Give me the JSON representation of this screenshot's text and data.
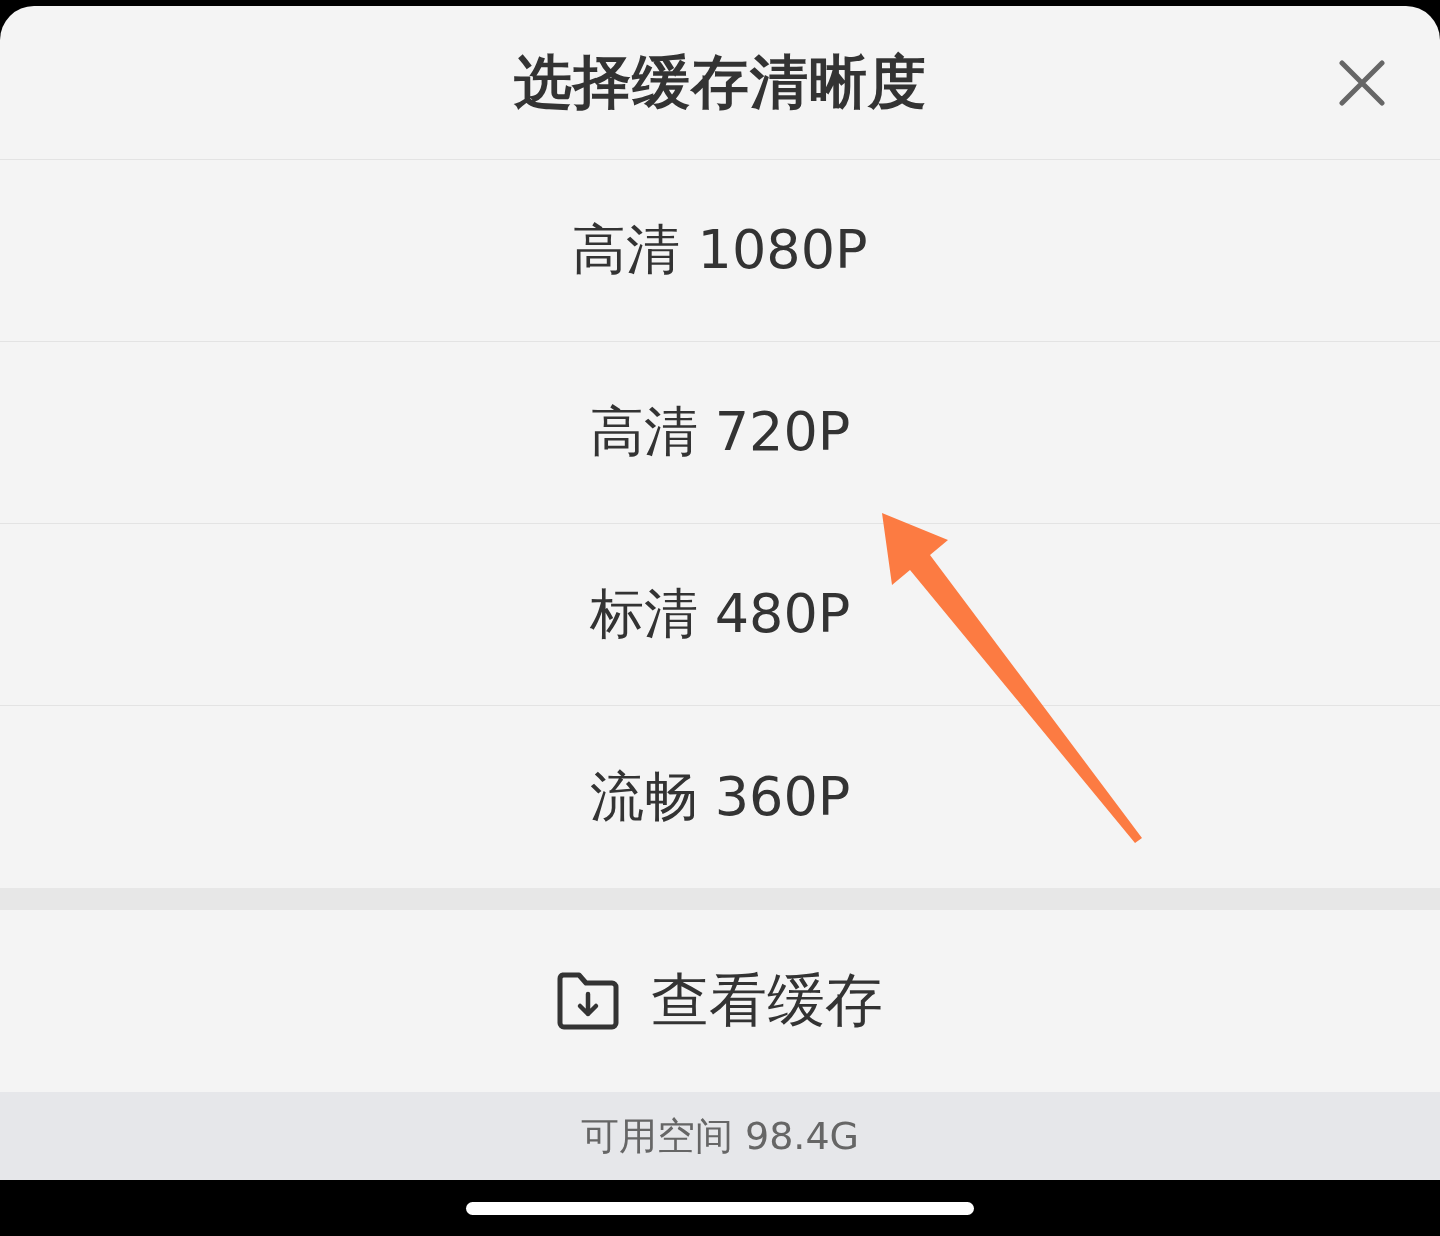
{
  "sheet": {
    "title": "选择缓存清晰度"
  },
  "options": [
    {
      "label": "高清 1080P"
    },
    {
      "label": "高清 720P"
    },
    {
      "label": "标清 480P"
    },
    {
      "label": "流畅 360P"
    }
  ],
  "view_cache_button": {
    "label": "查看缓存"
  },
  "footer": {
    "free_space": "可用空间 98.4G"
  }
}
